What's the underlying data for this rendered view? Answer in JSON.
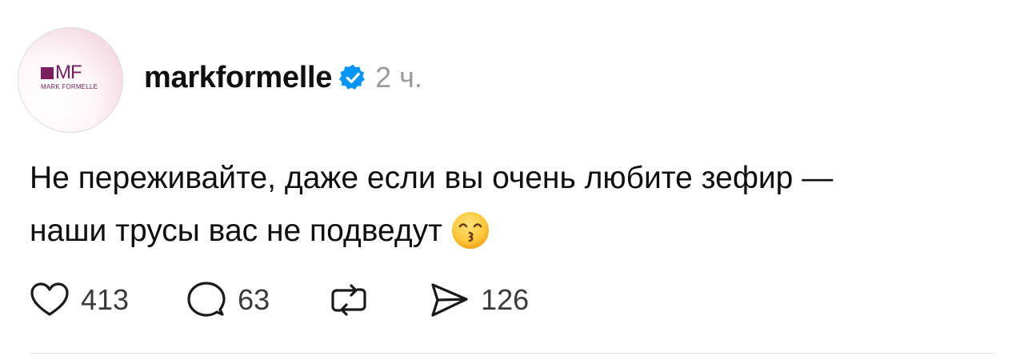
{
  "author": {
    "username": "markformelle",
    "verified": true,
    "time": "2 ч.",
    "avatar": {
      "logo_text": "MF",
      "logo_caption": "MARK FORMELLE",
      "brand_color": "#7b1e5f"
    }
  },
  "post": {
    "line1": "Не переживайте, даже если вы очень любите зефир —",
    "line2": "наши трусы вас не подведут",
    "emoji": "kissing-face-with-smiling-eyes"
  },
  "actions": {
    "likes": "413",
    "replies": "63",
    "reposts": "",
    "shares": "126"
  },
  "colors": {
    "text": "#0f0f0f",
    "muted": "#9a9a9a",
    "verified_badge": "#0095f6",
    "divider": "#e4e4e4"
  }
}
